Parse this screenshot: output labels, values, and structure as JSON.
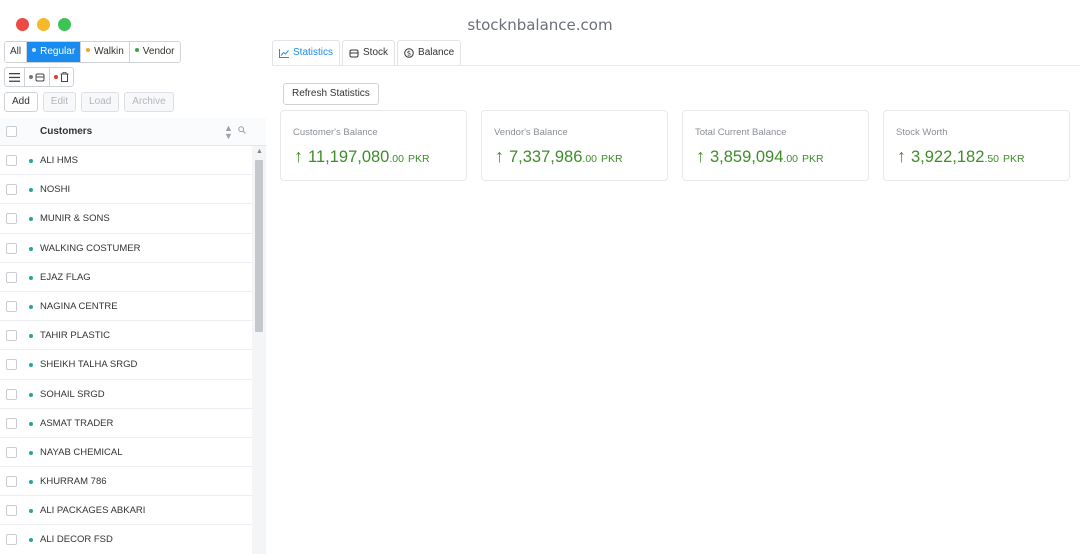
{
  "window": {
    "title": "stocknbalance.com"
  },
  "filters": {
    "all": "All",
    "regular": "Regular",
    "walkin": "Walkin",
    "vendor": "Vendor",
    "colors": {
      "regular": "#ffffff",
      "walkin": "#f5a623",
      "vendor": "#43a047"
    }
  },
  "actions": {
    "add": "Add",
    "edit": "Edit",
    "load": "Load",
    "archive": "Archive"
  },
  "table": {
    "header": "Customers",
    "rows": [
      "ALI HMS",
      "NOSHI",
      "MUNIR & SONS",
      "WALKING COSTUMER",
      "EJAZ FLAG",
      "NAGINA CENTRE",
      "TAHIR PLASTIC",
      "SHEIKH TALHA SRGD",
      "SOHAIL SRGD",
      "ASMAT TRADER",
      "NAYAB CHEMICAL",
      "KHURRAM 786",
      "ALI PACKAGES ABKARI",
      "ALI DECOR FSD"
    ]
  },
  "tabs": {
    "statistics": "Statistics",
    "stock": "Stock",
    "balance": "Balance"
  },
  "refresh": "Refresh Statistics",
  "cards": [
    {
      "label": "Customer's Balance",
      "whole": "11,197,080",
      "fraction": ".00",
      "currency": "PKR"
    },
    {
      "label": "Vendor's Balance",
      "whole": "7,337,986",
      "fraction": ".00",
      "currency": "PKR"
    },
    {
      "label": "Total Current Balance",
      "whole": "3,859,094",
      "fraction": ".00",
      "currency": "PKR"
    },
    {
      "label": "Stock Worth",
      "whole": "3,922,182",
      "fraction": ".50",
      "currency": "PKR"
    }
  ],
  "accent": "#1a8cf0",
  "positive_color": "#3f8d2a"
}
